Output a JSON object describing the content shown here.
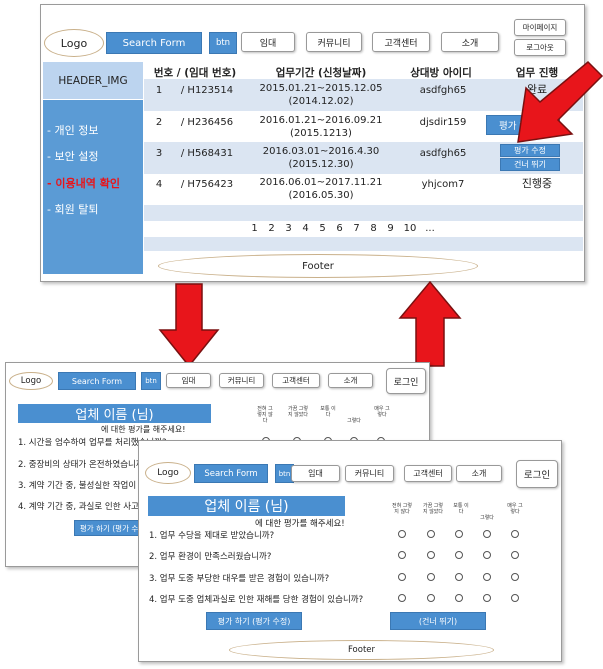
{
  "top": {
    "logo": "Logo",
    "search": "Search Form",
    "btn": "btn",
    "nav": [
      "임대",
      "커뮤니티",
      "고객센터",
      "소개"
    ],
    "mypage": "마이페이지",
    "logout": "로그아웃",
    "header_img": "HEADER_IMG",
    "sidebar": [
      "- 개인 정보",
      "- 보안 설정",
      "- 이용내역 확인",
      "- 회원 탈퇴"
    ],
    "headers": [
      "번호 / (임대 번호)",
      "업무기간 (신청날짜)",
      "상대방 아이디",
      "업무 진행"
    ],
    "rows": [
      {
        "no": "1",
        "id": "/ H123514",
        "period": "2015.01.21~2015.12.05",
        "applied": "(2014.12.02)",
        "partner": "asdfgh65",
        "status": "완료"
      },
      {
        "no": "2",
        "id": "/ H236456",
        "period": "2016.01.21~2016.09.21",
        "applied": "(2015.1213)",
        "partner": "djsdir159",
        "status": "평가 하기"
      },
      {
        "no": "3",
        "id": "/ H568431",
        "period": "2016.03.01~2016.4.30",
        "applied": "(2015.12.30)",
        "partner": "asdfgh65",
        "status": "평가 수정",
        "status2": "건너 뛰기"
      },
      {
        "no": "4",
        "id": "/ H756423",
        "period": "2016.06.01~2017.11.21",
        "applied": "(2016.05.30)",
        "partner": "yhjcom7",
        "status": "진행중"
      }
    ],
    "pages": [
      "1",
      "2",
      "3",
      "4",
      "5",
      "6",
      "7",
      "8",
      "9",
      "10",
      "..."
    ],
    "footer": "Footer"
  },
  "back": {
    "logo": "Logo",
    "search": "Search Form",
    "btn": "btn",
    "nav": [
      "임대",
      "커뮤니티",
      "고객센터",
      "소개"
    ],
    "login": "로그인",
    "company": "업체 이름 (님)",
    "subtitle": "에 대한 평가를 해주세요!",
    "scale": [
      "전혀 그렇지 않다",
      "가끔 그렇지 않았다",
      "보통 이다",
      "그렇다",
      "매우 그렇다"
    ],
    "questions": [
      "1. 시간을 엄수하여 업무를 처리했습니까?",
      "2. 중장비의 상태가 온전하였습니까?",
      "3. 계약 기간 중, 불성실한 작업이 있었습니까?",
      "4. 계약 기간 중, 과실로 인한 사고가 있었습니까?"
    ],
    "submit": "평가 하기 (평가 수정)"
  },
  "front": {
    "logo": "Logo",
    "search": "Search Form",
    "btn": "btn",
    "nav": [
      "임대",
      "커뮤니티",
      "고객센터",
      "소개"
    ],
    "login": "로그인",
    "company": "업체 이름 (님)",
    "subtitle": "에 대한 평가를 해주세요!",
    "scale": [
      "전혀 그렇지 않다",
      "가끔 그렇지 않았다",
      "보통 이다",
      "그렇다",
      "매우 그렇다"
    ],
    "questions": [
      "1. 업무 수당을 제대로 받았습니까?",
      "2. 업무 환경이 만족스러웠습니까?",
      "3. 업무 도중 부당한 대우를 받은 경험이 있습니까?",
      "4. 업무 도중 업체과실로 인한 재해를 당한 경험이 있습니까?"
    ],
    "submit": "평가 하기 (평가 수정)",
    "skip": "(건너 뛰기)",
    "footer": "Footer"
  },
  "colors": {
    "blue": "#4a8fd0",
    "sidebar": "#5b9bd5",
    "red": "#e8151b",
    "stripe": "#dbe5f2"
  }
}
